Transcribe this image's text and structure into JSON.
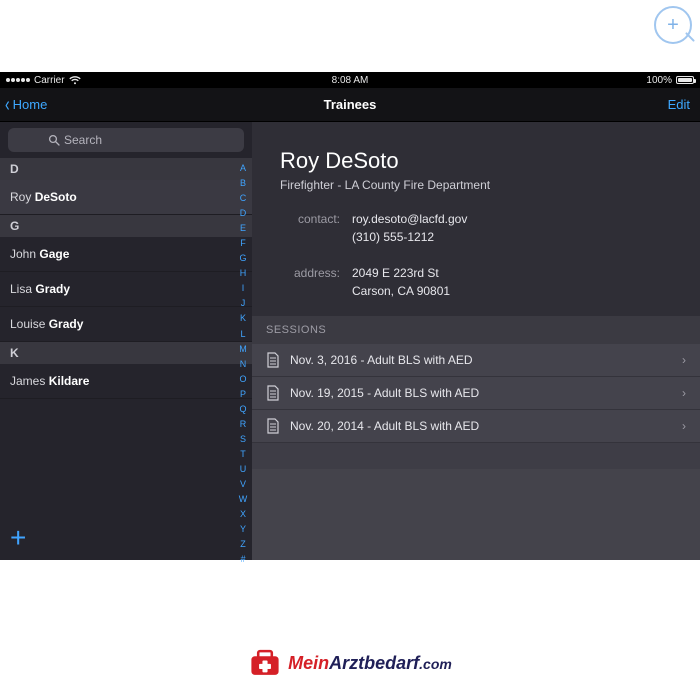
{
  "statusbar": {
    "carrier": "Carrier",
    "time": "8:08 AM",
    "battery": "100%"
  },
  "navbar": {
    "back": "Home",
    "title": "Trainees",
    "edit": "Edit"
  },
  "search": {
    "placeholder": "Search"
  },
  "index_letters": [
    "A",
    "B",
    "C",
    "D",
    "E",
    "F",
    "G",
    "H",
    "I",
    "J",
    "K",
    "L",
    "M",
    "N",
    "O",
    "P",
    "Q",
    "R",
    "S",
    "T",
    "U",
    "V",
    "W",
    "X",
    "Y",
    "Z",
    "#"
  ],
  "sections": [
    {
      "letter": "D",
      "rows": [
        {
          "first": "Roy",
          "last": "DeSoto",
          "selected": true
        }
      ]
    },
    {
      "letter": "G",
      "rows": [
        {
          "first": "John",
          "last": "Gage"
        },
        {
          "first": "Lisa",
          "last": "Grady"
        },
        {
          "first": "Louise",
          "last": "Grady"
        }
      ]
    },
    {
      "letter": "K",
      "rows": [
        {
          "first": "James",
          "last": "Kildare"
        }
      ]
    }
  ],
  "detail": {
    "name": "Roy DeSoto",
    "subtitle": "Firefighter - LA County Fire Department",
    "labels": {
      "contact": "contact:",
      "address": "address:"
    },
    "contact_email": "roy.desoto@lacfd.gov",
    "contact_phone": "(310) 555-1212",
    "address_line1": "2049 E 223rd St",
    "address_line2": "Carson, CA 90801"
  },
  "sessions": {
    "header": "SESSIONS",
    "items": [
      "Nov. 3, 2016 - Adult BLS with AED",
      "Nov. 19, 2015 - Adult BLS with AED",
      "Nov. 20, 2014 - Adult BLS with AED"
    ]
  },
  "watermark": {
    "mein": "Mein",
    "rest": "Arztbedarf",
    "com": ".com"
  }
}
